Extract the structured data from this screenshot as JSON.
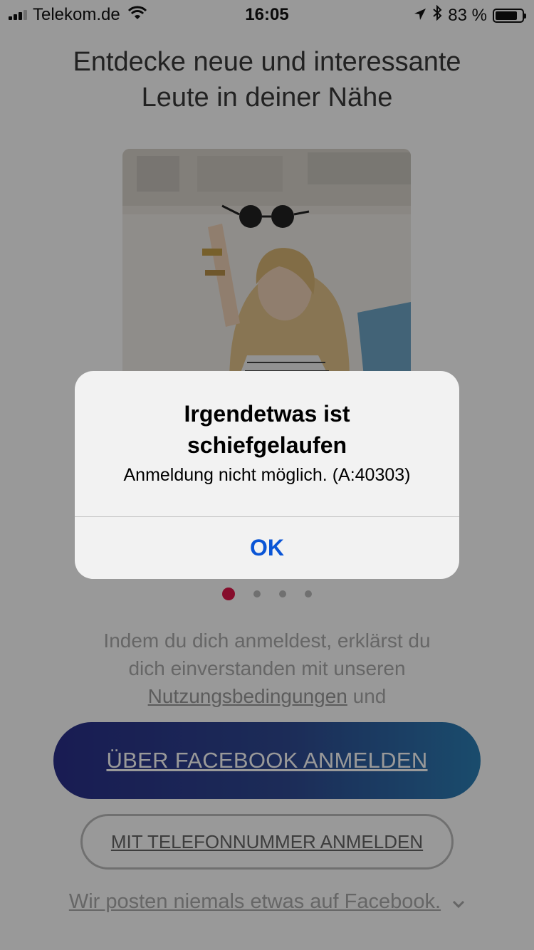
{
  "status_bar": {
    "carrier": "Telekom.de",
    "time": "16:05",
    "battery_percent": "83 %",
    "battery_level": 0.83
  },
  "onboarding": {
    "headline_line1": "Entdecke neue und interessante",
    "headline_line2": "Leute in deiner Nähe",
    "carousel_active_index": 0,
    "carousel_count": 4
  },
  "legal": {
    "line1": "Indem du dich anmeldest, erklärst du",
    "line2": "dich einverstanden mit unseren",
    "terms_link": "Nutzungsbedingungen",
    "and": " und"
  },
  "buttons": {
    "facebook_login": "ÜBER FACEBOOK ANMELDEN",
    "phone_login": "MIT TELEFONNUMMER ANMELDEN"
  },
  "footer": {
    "note": "Wir posten niemals etwas auf Facebook."
  },
  "alert": {
    "title_line1": "Irgendetwas ist",
    "title_line2": "schiefgelaufen",
    "message": "Anmeldung nicht möglich. (A:40303)",
    "ok_label": "OK"
  },
  "colors": {
    "accent_pink": "#e0174a",
    "alert_button_blue": "#0a55d6",
    "fb_gradient_start": "#2a2f8a",
    "fb_gradient_end": "#2c7fb5"
  }
}
